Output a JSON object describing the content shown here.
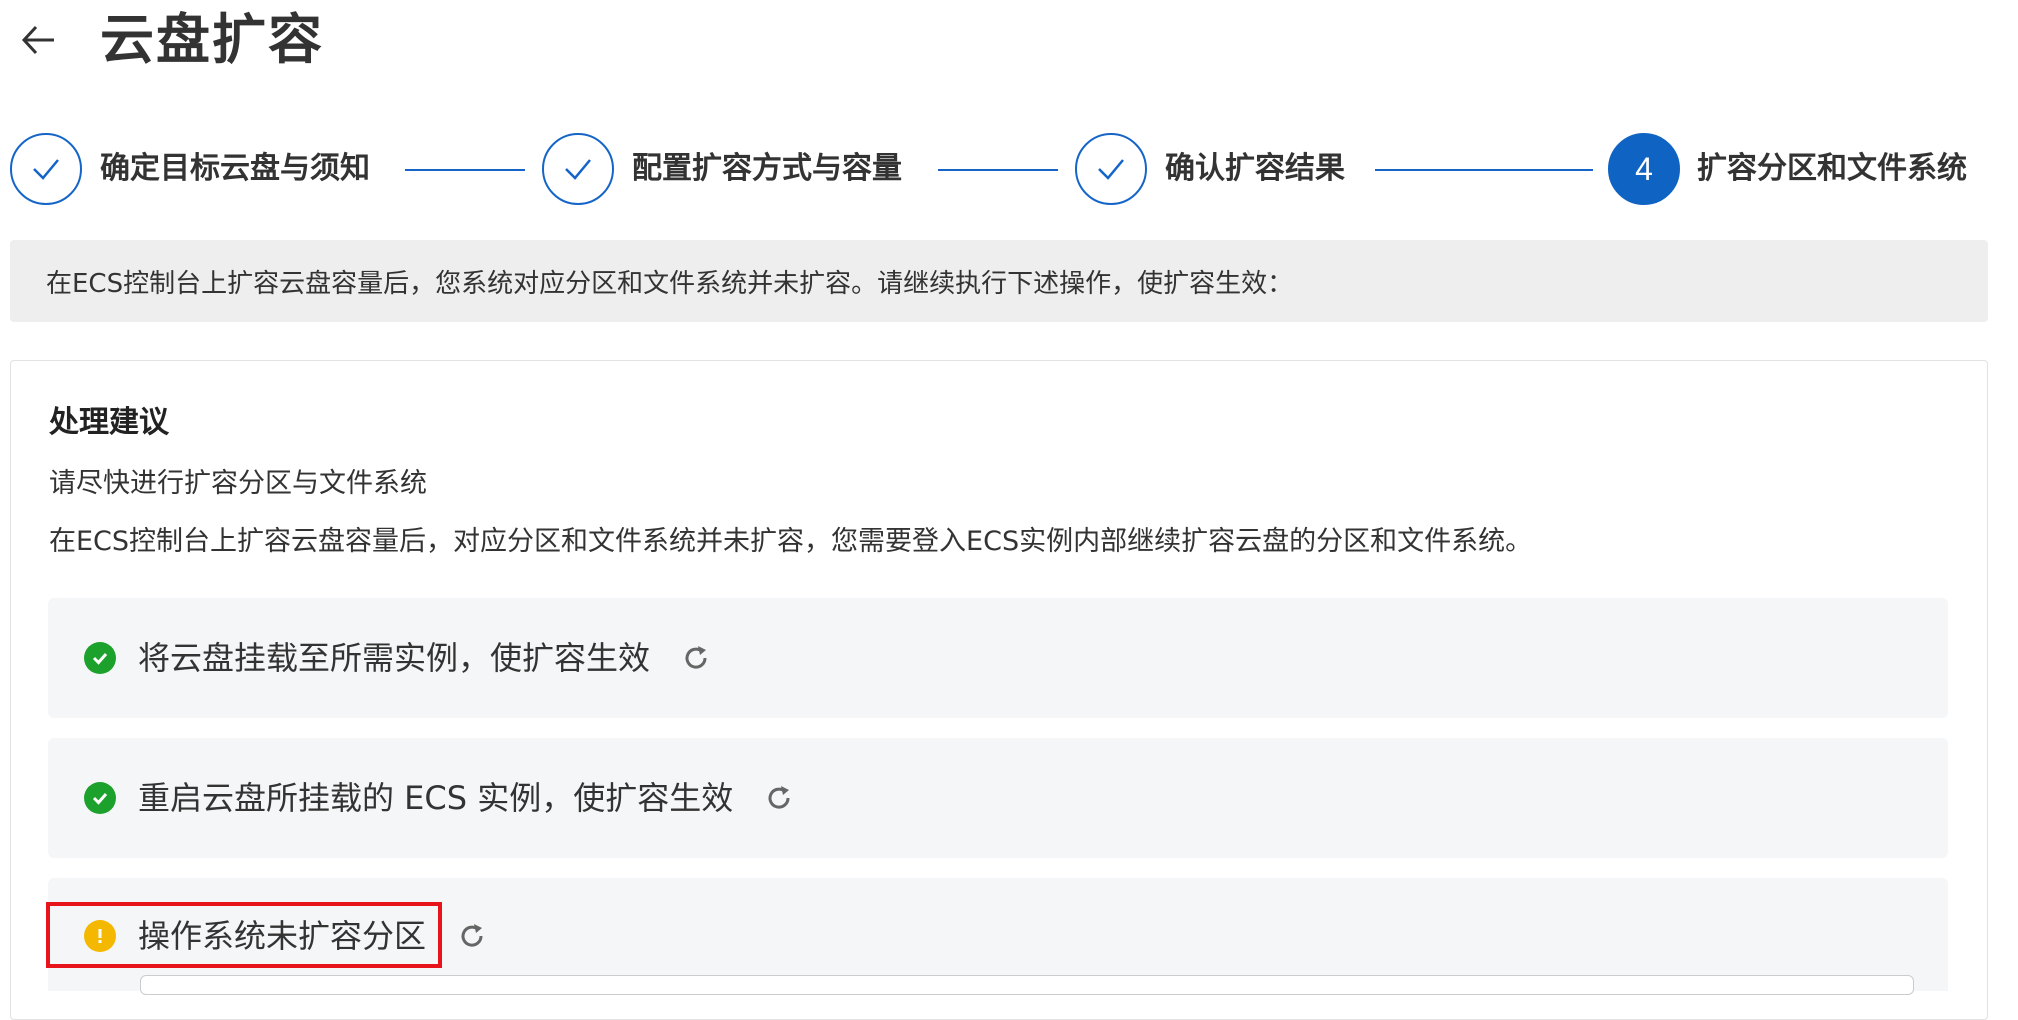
{
  "header": {
    "back_icon": "arrow-left-icon",
    "title": "云盘扩容"
  },
  "steps": [
    {
      "label": "确定目标云盘与须知",
      "status": "done",
      "icon": "check-icon"
    },
    {
      "label": "配置扩容方式与容量",
      "status": "done",
      "icon": "check-icon"
    },
    {
      "label": "确认扩容结果",
      "status": "done",
      "icon": "check-icon"
    },
    {
      "label": "扩容分区和文件系统",
      "status": "active",
      "number": "4"
    }
  ],
  "notice": {
    "text": "在ECS控制台上扩容云盘容量后，您系统对应分区和文件系统并未扩容。请继续执行下述操作，使扩容生效："
  },
  "panel": {
    "title": "处理建议",
    "text1": "请尽快进行扩容分区与文件系统",
    "text2": "在ECS控制台上扩容云盘容量后，对应分区和文件系统并未扩容，您需要登入ECS实例内部继续扩容云盘的分区和文件系统。",
    "tasks": [
      {
        "label": "将云盘挂载至所需实例，使扩容生效",
        "status": "success",
        "status_icon": "check-circle-icon",
        "action_icon": "refresh-icon"
      },
      {
        "label": "重启云盘所挂载的 ECS 实例，使扩容生效",
        "status": "success",
        "status_icon": "check-circle-icon",
        "action_icon": "refresh-icon"
      },
      {
        "label": "操作系统未扩容分区",
        "status": "warning",
        "status_icon": "exclamation-circle-icon",
        "action_icon": "refresh-icon"
      }
    ]
  },
  "colors": {
    "primary": "#0f63c3",
    "success": "#1ca12c",
    "warning": "#f5b800",
    "highlight": "#e8141b",
    "notice_bg": "#eeeeee",
    "task_bg": "#f5f6f7"
  }
}
